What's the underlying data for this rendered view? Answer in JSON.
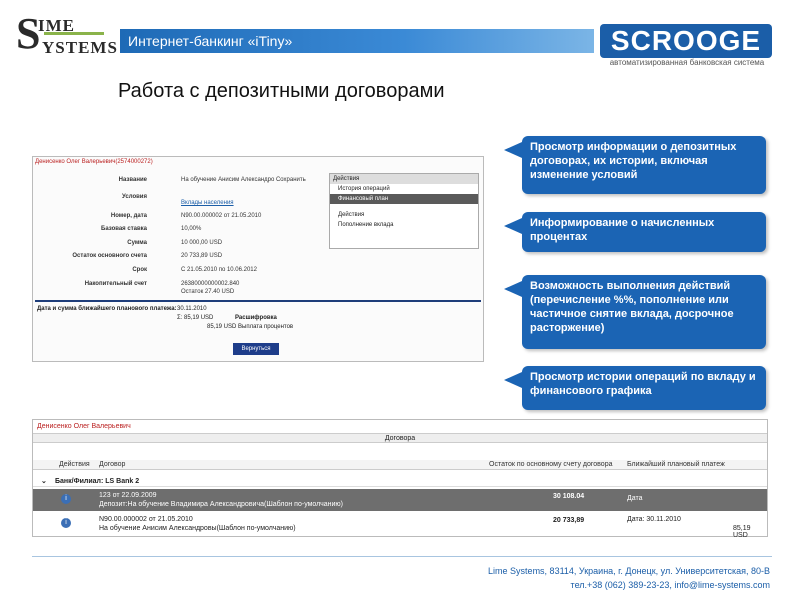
{
  "header": {
    "logo_line1": "IME",
    "logo_line2": "YSTEMS",
    "logo_initial": "S",
    "banner": "Интернет-банкинг «iTiny»",
    "brand": "SCROOGE",
    "brand_sub": "автоматизированная банковская система"
  },
  "page_title": "Работа с депозитными договорами",
  "shot1": {
    "user": "Денисенко Олег Валерьевич(2574000272)",
    "fields": [
      {
        "k": "Название",
        "v": "На обучение Анисим Александро  Сохранить"
      },
      {
        "k": "Условия",
        "v": "Вклады населения"
      },
      {
        "k": "Номер, дата",
        "v": "N90.00.000002   от  21.05.2010"
      },
      {
        "k": "Базовая ставка",
        "v": "10,00%"
      },
      {
        "k": "Сумма",
        "v": "10 000,00   USD"
      },
      {
        "k": "Остаток основного счета",
        "v": "20 733,89   USD"
      },
      {
        "k": "Срок",
        "v": "С 21.05.2010  по 10.06.2012"
      },
      {
        "k": "Накопительный счет",
        "v": "26380000000002.840"
      },
      {
        "k": "",
        "v": "Остаток 27.40 USD"
      }
    ],
    "actions_header": "Действия",
    "actions": [
      "История операций",
      "Финансовый план",
      "Действия",
      "Пополнение вклада"
    ],
    "next_payment_label": "Дата и сумма ближайшего планового платежа:",
    "next_payment_date": "30.11.2010",
    "next_payment_total": "Σ:  85,19 USD",
    "breakdown_label": "Расшифровка",
    "breakdown_line": "85,19 USD  Выплата процентов",
    "back_button": "Вернуться"
  },
  "callouts": [
    "Просмотр  информации о депозитных договорах, их истории, включая изменение условий",
    "Информирование о начисленных процентах",
    "Возможность выполнения действий (перечисление %%, пополнение или частичное снятие вклада, досрочное расторжение)",
    "Просмотр истории операций по вкладу и финансового графика"
  ],
  "shot2": {
    "user": "Денисенко Олег Валерьевич",
    "section": "Договора",
    "columns": {
      "actions": "Действия",
      "contract": "Договор",
      "balance": "Остаток по основному счету договора",
      "next": "Ближайший плановый платеж"
    },
    "group": "Банк/Филиал: LS Bank 2",
    "rows": [
      {
        "line1": "123 от 22.09.2009",
        "line2": "Депозит:На обучение Владимира Александровича(Шаблон по-умолчанию)",
        "amount": "30 108.04",
        "date": "Дата",
        "plan": ""
      },
      {
        "line1": "N90.00.000002 от 21.05.2010",
        "line2": "На обучение Анисим Александровы(Шаблон по-умолчанию)",
        "amount": "20 733,89",
        "date": "Дата: 30.11.2010",
        "plan": "85,19 USD"
      }
    ]
  },
  "footer": {
    "line1": "Lime Systems, 83114, Украина, г. Донецк, ул. Университетская, 80-В",
    "line2": "тел.+38 (062) 389-23-23, info@lime-systems.com"
  }
}
